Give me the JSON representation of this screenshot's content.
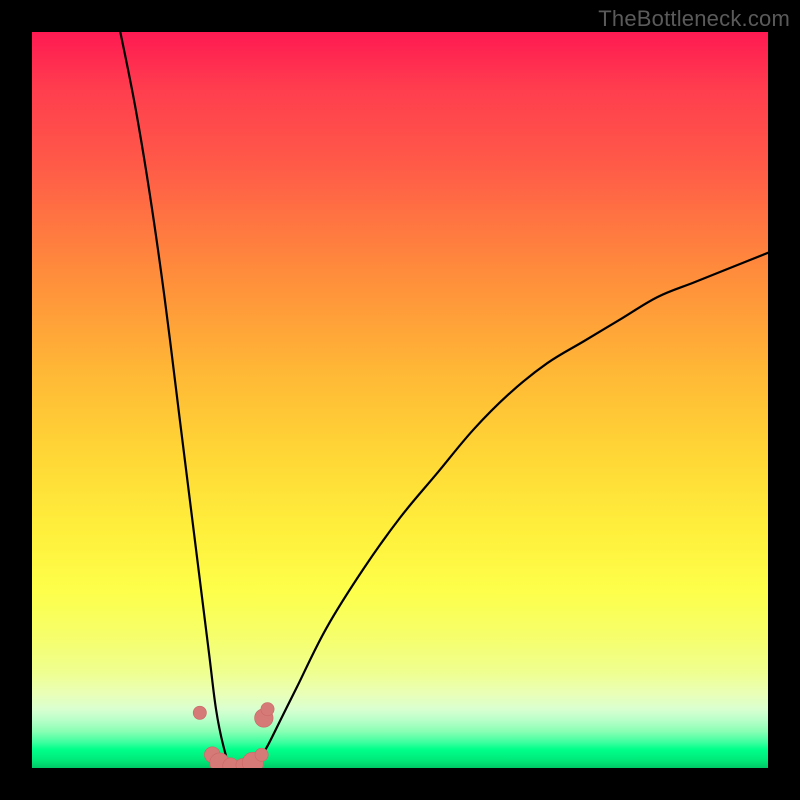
{
  "watermark": "TheBottleneck.com",
  "colors": {
    "background": "#000000",
    "curve": "#000000",
    "marker_fill": "#d67a77",
    "marker_stroke": "#c96865"
  },
  "chart_data": {
    "type": "line",
    "title": "",
    "xlabel": "",
    "ylabel": "",
    "xlim": [
      0,
      100
    ],
    "ylim": [
      0,
      100
    ],
    "grid": false,
    "legend": false,
    "notes": "V-shaped bottleneck curve on a vertical red→yellow→green heat gradient. Y is bottleneck percentage (0 = green at bottom, 100 = red at top). Minimum (~0%) near x≈27. Left branch is near-vertical; right branch rises and decelerates toward ~70% at x=100. Values estimated from pixel positions; no axis labels shown.",
    "series": [
      {
        "name": "bottleneck-curve",
        "x": [
          12,
          14,
          16,
          18,
          20,
          22,
          24,
          25,
          26,
          27,
          28,
          29,
          30,
          31,
          32,
          34,
          36,
          40,
          45,
          50,
          55,
          60,
          65,
          70,
          75,
          80,
          85,
          90,
          95,
          100
        ],
        "y": [
          100,
          90,
          78,
          64,
          48,
          32,
          16,
          8,
          3,
          0,
          0,
          0,
          0.5,
          1.5,
          3,
          7,
          11,
          19,
          27,
          34,
          40,
          46,
          51,
          55,
          58,
          61,
          64,
          66,
          68,
          70
        ]
      }
    ],
    "markers": [
      {
        "x": 22.8,
        "y": 7.5,
        "r": 1.0
      },
      {
        "x": 24.5,
        "y": 1.8,
        "r": 1.2
      },
      {
        "x": 25.5,
        "y": 0.7,
        "r": 1.5
      },
      {
        "x": 27.0,
        "y": 0.3,
        "r": 1.2
      },
      {
        "x": 28.6,
        "y": 0.4,
        "r": 1.0
      },
      {
        "x": 30.0,
        "y": 0.7,
        "r": 1.6
      },
      {
        "x": 31.2,
        "y": 1.8,
        "r": 1.0
      },
      {
        "x": 31.5,
        "y": 6.8,
        "r": 1.4
      },
      {
        "x": 32.0,
        "y": 8.0,
        "r": 1.0
      }
    ]
  }
}
